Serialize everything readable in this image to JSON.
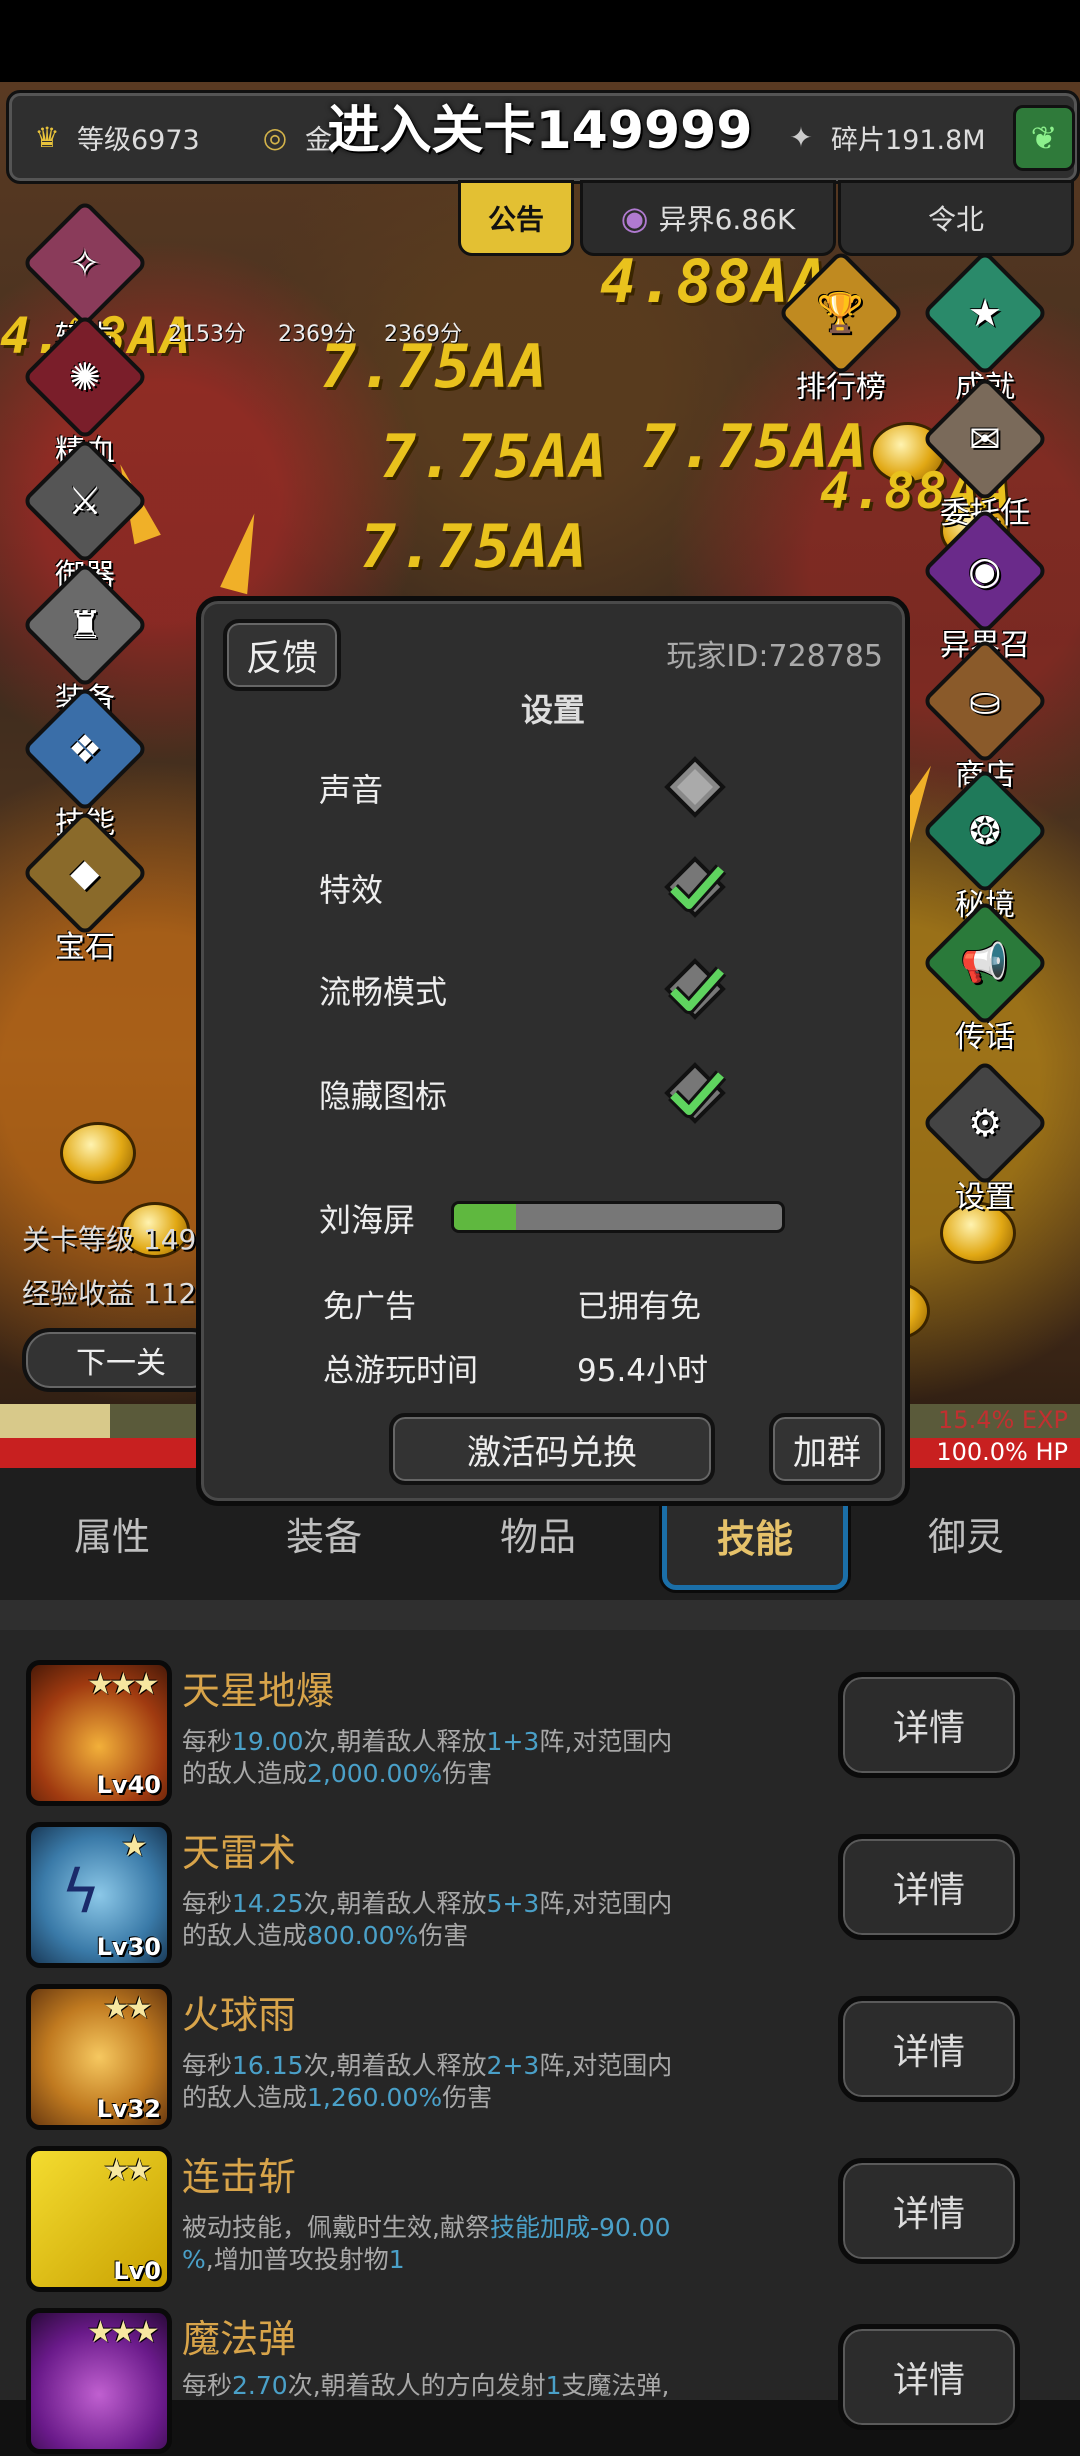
{
  "level_banner": "进入关卡149999",
  "topbar": {
    "level": "等级6973",
    "gold": "金",
    "fragments": "碎片191.8M"
  },
  "toptabs": {
    "notice": "公告",
    "otherworld": "异界6.86K",
    "lingbei": "令北"
  },
  "scores": [
    "2153分",
    "2369分",
    "2369分"
  ],
  "damage_texts": [
    "7.75AA",
    "7.75AA",
    "7.75AA",
    "7.75AA",
    "4.88AA",
    "4.88AA",
    "4.88AA"
  ],
  "left_menu": [
    "转生",
    "精血",
    "御器",
    "装备",
    "技能",
    "宝石"
  ],
  "right_menu": [
    "排行榜",
    "成就",
    "委托任务",
    "异界召唤",
    "商店",
    "秘境",
    "传话",
    "设置"
  ],
  "stage_info": {
    "stage_level": "关卡等级 149",
    "exp_income": "经验收益 112",
    "next_label": "下一关"
  },
  "bars": {
    "exp_label": "15.4% EXP",
    "hp_label": "100.0% HP",
    "exp_percent": 15.4
  },
  "settings": {
    "feedback": "反馈",
    "player_id": "玩家ID:728785",
    "title": "设置",
    "options": [
      {
        "label": "声音",
        "checked": false
      },
      {
        "label": "特效",
        "checked": true
      },
      {
        "label": "流畅模式",
        "checked": true
      },
      {
        "label": "隐藏图标",
        "checked": true
      }
    ],
    "notch_label": "刘海屏",
    "notch_value": 0.19,
    "no_ads_label": "免广告",
    "no_ads_value": "已拥有免",
    "playtime_label": "总游玩时间",
    "playtime_value": "95.4小时",
    "redeem_button": "激活码兑换",
    "group_button": "加群"
  },
  "bottom_tabs": [
    "属性",
    "装备",
    "物品",
    "技能",
    "御灵"
  ],
  "active_tab": "技能",
  "skills": [
    {
      "name": "天星地爆",
      "level": "Lv40",
      "stars": "★★★",
      "d1": "每秒",
      "n1": "19.00",
      "d2": "次,朝着敌人释放",
      "n2": "1+3",
      "d3": "阵,对范围内",
      "d4": "的敌人造成",
      "n3": "2,000.00%",
      "d5": "伤害"
    },
    {
      "name": "天雷术",
      "level": "Lv30",
      "stars": "★",
      "d1": "每秒",
      "n1": "14.25",
      "d2": "次,朝着敌人释放",
      "n2": "5+3",
      "d3": "阵,对范围内",
      "d4": "的敌人造成",
      "n3": "800.00%",
      "d5": "伤害"
    },
    {
      "name": "火球雨",
      "level": "Lv32",
      "stars": "★★",
      "d1": "每秒",
      "n1": "16.15",
      "d2": "次,朝着敌人释放",
      "n2": "2+3",
      "d3": "阵,对范围内",
      "d4": "的敌人造成",
      "n3": "1,260.00%",
      "d5": "伤害"
    },
    {
      "name": "连击斩",
      "level": "Lv0",
      "stars": "★★",
      "d1": "被动技能，佩戴时生效,献祭",
      "n1": "技能加成-90.00",
      "d2": "",
      "n2": "",
      "d3": "",
      "d4": "",
      "n3": "%",
      "d5": ",增加普攻投射物",
      "n4": "1"
    },
    {
      "name": "魔法弹",
      "level": "",
      "stars": "★★★",
      "d1": "每秒",
      "n1": "2.70",
      "d2": "次,朝着敌人的方向发射",
      "n2": "1",
      "d3": "支魔法弹,",
      "d4": "",
      "n3": "",
      "d5": ""
    }
  ],
  "detail_label": "详情"
}
